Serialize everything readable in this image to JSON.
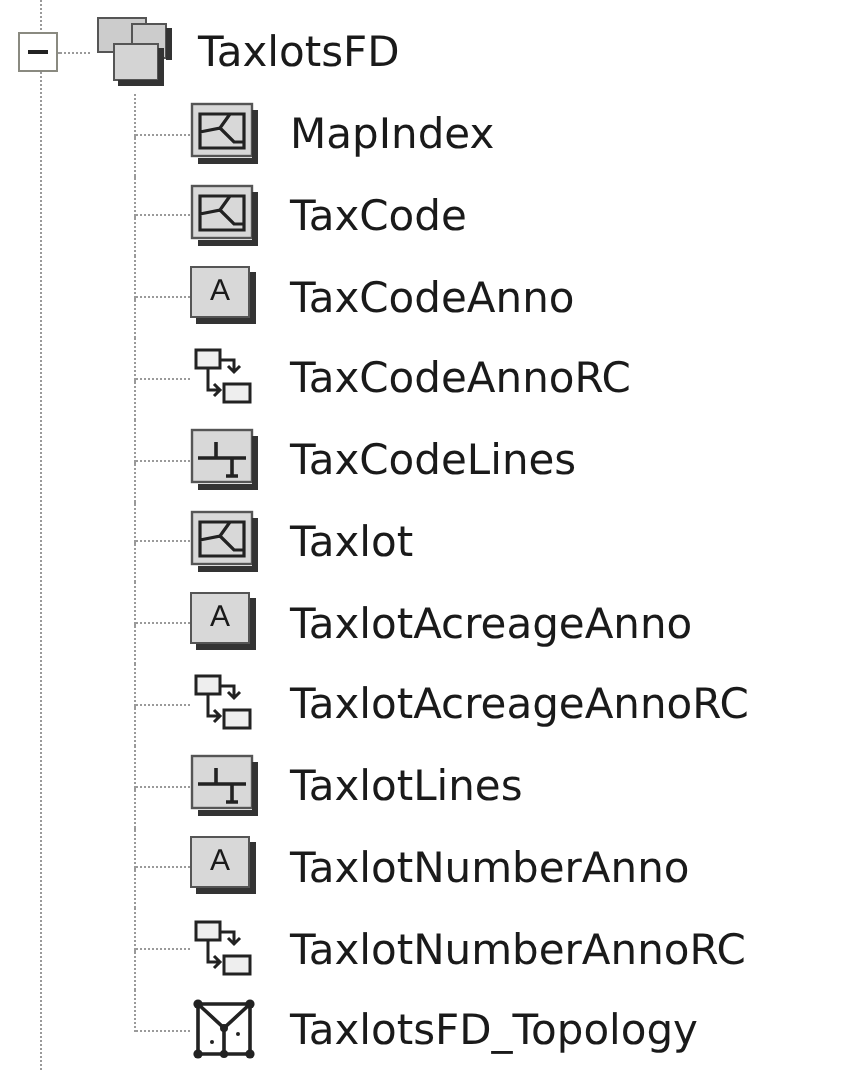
{
  "tree": {
    "label": "TaxlotsFD",
    "expanded": true,
    "children": [
      {
        "label": "MapIndex",
        "kind": "polygon"
      },
      {
        "label": "TaxCode",
        "kind": "polygon"
      },
      {
        "label": "TaxCodeAnno",
        "kind": "annotation",
        "glyph": "A"
      },
      {
        "label": "TaxCodeAnnoRC",
        "kind": "relationship"
      },
      {
        "label": "TaxCodeLines",
        "kind": "line"
      },
      {
        "label": "Taxlot",
        "kind": "polygon"
      },
      {
        "label": "TaxlotAcreageAnno",
        "kind": "annotation",
        "glyph": "A"
      },
      {
        "label": "TaxlotAcreageAnnoRC",
        "kind": "relationship"
      },
      {
        "label": "TaxlotLines",
        "kind": "line"
      },
      {
        "label": "TaxlotNumberAnno",
        "kind": "annotation",
        "glyph": "A"
      },
      {
        "label": "TaxlotNumberAnnoRC",
        "kind": "relationship"
      },
      {
        "label": "TaxlotsFD_Topology",
        "kind": "topology"
      }
    ]
  }
}
